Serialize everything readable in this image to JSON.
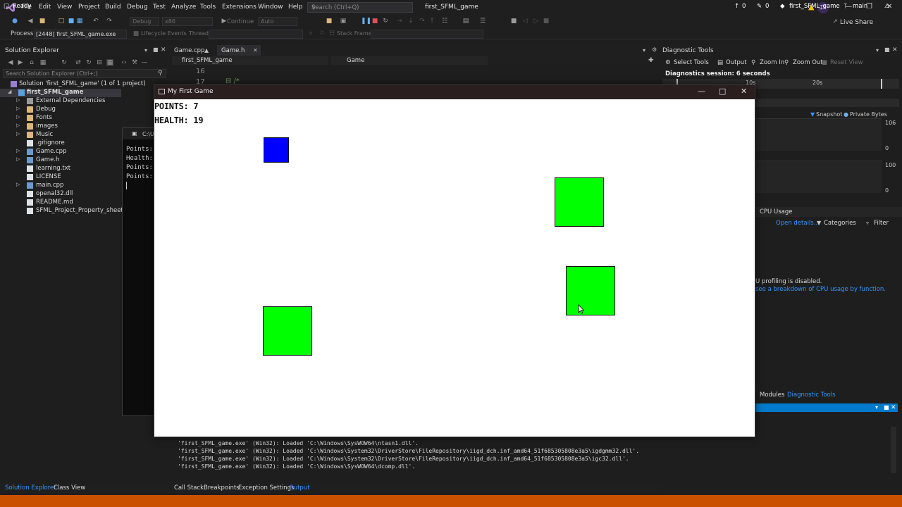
{
  "menubar": {
    "items": [
      "File",
      "Edit",
      "View",
      "Project",
      "Build",
      "Debug",
      "Test",
      "Analyze",
      "Tools",
      "Extensions",
      "Window",
      "Help"
    ],
    "search_placeholder": "Search (Ctrl+Q)",
    "solution_name": "first_SFML_game",
    "avatar_initials": "TP"
  },
  "toolbar": {
    "config": "Debug",
    "platform": "x86",
    "continue_label": "Continue",
    "auto_label": "Auto",
    "live_share": "Live Share",
    "process_label": "Process:",
    "process_value": "[2448] first_SFML_game.exe",
    "lifecycle_label": "Lifecycle Events",
    "thread_label": "Thread:",
    "stack_frame_label": "Stack Frame:"
  },
  "solution_explorer": {
    "title": "Solution Explorer",
    "search_placeholder": "Search Solution Explorer (Ctrl+;)",
    "solution_label": "Solution 'first_SFML_game' (1 of 1 project)",
    "project_label": "first_SFML_game",
    "items": [
      {
        "label": "External Dependencies",
        "kind": "dep"
      },
      {
        "label": "Debug",
        "kind": "folder"
      },
      {
        "label": "Fonts",
        "kind": "folder"
      },
      {
        "label": "images",
        "kind": "folder"
      },
      {
        "label": "Music",
        "kind": "folder"
      },
      {
        "label": ".gitignore",
        "kind": "file"
      },
      {
        "label": "Game.cpp",
        "kind": "cpp"
      },
      {
        "label": "Game.h",
        "kind": "cpp"
      },
      {
        "label": "learning.txt",
        "kind": "file"
      },
      {
        "label": "LICENSE",
        "kind": "file"
      },
      {
        "label": "main.cpp",
        "kind": "cpp"
      },
      {
        "label": "openal32.dll",
        "kind": "file"
      },
      {
        "label": "README.md",
        "kind": "file"
      },
      {
        "label": "SFML_Project_Property_sheet.props",
        "kind": "file"
      }
    ],
    "bottom_tabs": [
      "Solution Explorer",
      "Class View"
    ]
  },
  "editor": {
    "tabs": [
      "Game.cpp",
      "Game.h"
    ],
    "nav_left": "first_SFML_game",
    "nav_right": "Game",
    "line_numbers": [
      "16",
      "17"
    ]
  },
  "console": {
    "title": "C:\\U",
    "lines": [
      "Points:",
      "Health:",
      "Points:",
      "Points:"
    ]
  },
  "game_window": {
    "title": "My First Game",
    "points_text": "POINTS: 7",
    "health_text": "HEALTH: 19"
  },
  "diagnostic_tools": {
    "title": "Diagnostic Tools",
    "tools": [
      "Select Tools",
      "Output",
      "Zoom In",
      "Zoom Out",
      "Reset View"
    ],
    "session": "Diagnostics session: 6 seconds",
    "timeline_label": "20s",
    "timeline_label_short": "10s",
    "legend": [
      "Snapshot",
      "Private Bytes"
    ],
    "axis": [
      "106",
      "0",
      "100",
      "0"
    ],
    "cpu_tab": "CPU Usage",
    "open_details": "Open details...",
    "categories": "Categories",
    "filter": "Filter",
    "cpu_msg": "U profiling is disabled.",
    "cpu_link": "see a breakdown of CPU usage by function.",
    "bottom_tabs": [
      "Modules",
      "Diagnostic Tools"
    ]
  },
  "output": {
    "lines": [
      "'first_SFML_game.exe' (Win32): Loaded 'C:\\Windows\\SysWOW64\\ntasn1.dll'.",
      "'first_SFML_game.exe' (Win32): Loaded 'C:\\Windows\\System32\\DriverStore\\FileRepository\\iigd_dch.inf_amd64_51f685305808e3a5\\igdgmm32.dll'.",
      "'first_SFML_game.exe' (Win32): Loaded 'C:\\Windows\\System32\\DriverStore\\FileRepository\\iigd_dch.inf_amd64_51f685305808e3a5\\igc32.dll'.",
      "'first_SFML_game.exe' (Win32): Loaded 'C:\\Windows\\SysWOW64\\dcomp.dll'."
    ],
    "tabs": [
      "Call Stack",
      "Breakpoints",
      "Exception Settings",
      "Output"
    ]
  },
  "statusbar": {
    "ready": "Ready",
    "up_count": "0",
    "err_count": "0",
    "project": "first_SFML_game",
    "branch": "main"
  },
  "colors": {
    "blue_square": "#0000ff",
    "green_square": "#00ff00",
    "status_bar": "#ca5100"
  }
}
